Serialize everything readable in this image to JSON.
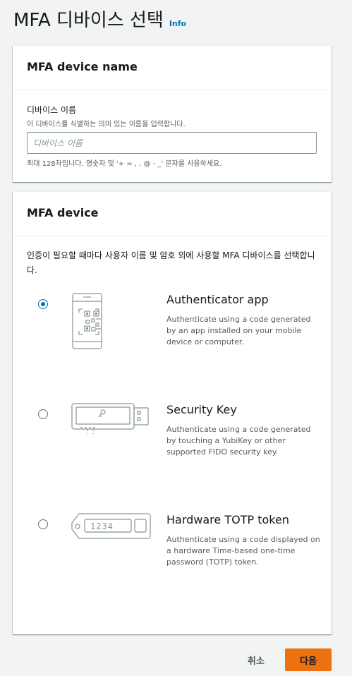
{
  "header": {
    "title": "MFA 디바이스 선택",
    "info_label": "Info"
  },
  "name_panel": {
    "title": "MFA device name",
    "field_label": "디바이스 이름",
    "field_description": "이 디바이스를 식별하는 의미 있는 이름을 입력합니다.",
    "input_value": "",
    "input_placeholder": "디바이스 이름",
    "constraint_text": "최대 128자입니다. 영숫자 및 '+ = , . @ - _' 문자를 사용하세요."
  },
  "device_panel": {
    "title": "MFA device",
    "description": "인증이 필요할 때마다 사용자 이름 및 암호 외에 사용할 MFA 디바이스를 선택합니다.",
    "selected": "authenticator-app",
    "options": [
      {
        "id": "authenticator-app",
        "icon": "phone-qr-icon",
        "title": "Authenticator app",
        "body": "Authenticate using a code generated by an app installed on your mobile device or computer."
      },
      {
        "id": "security-key",
        "icon": "usb-key-icon",
        "title": "Security Key",
        "body": "Authenticate using a code generated by touching a YubiKey or other supported FIDO security key."
      },
      {
        "id": "hardware-totp",
        "icon": "totp-token-icon",
        "title": "Hardware TOTP token",
        "body": "Authenticate using a code displayed on a hardware Time-based one-time password (TOTP) token.",
        "display_text": "1234"
      }
    ]
  },
  "footer": {
    "cancel_label": "취소",
    "next_label": "다음"
  },
  "colors": {
    "accent": "#0073bb",
    "primary_button": "#ec7211",
    "icon_stroke": "#879596"
  }
}
